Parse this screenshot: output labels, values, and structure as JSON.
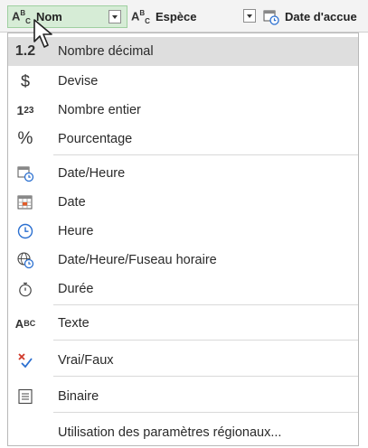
{
  "header": {
    "columns": [
      {
        "type_icon": "text-type-icon",
        "title": "Nom"
      },
      {
        "type_icon": "text-type-icon",
        "title": "Espèce"
      },
      {
        "type_icon": "date-type-icon",
        "title": "Date d'accue"
      }
    ]
  },
  "menu": {
    "items": [
      {
        "icon": "1.2",
        "label": "Nombre décimal"
      },
      {
        "icon": "$",
        "label": "Devise"
      },
      {
        "icon": "123",
        "label": "Nombre entier"
      },
      {
        "icon": "%",
        "label": "Pourcentage"
      },
      {
        "icon": "datetime-icon",
        "label": "Date/Heure"
      },
      {
        "icon": "calendar-icon",
        "label": "Date"
      },
      {
        "icon": "clock-icon",
        "label": "Heure"
      },
      {
        "icon": "globe-clock-icon",
        "label": "Date/Heure/Fuseau horaire"
      },
      {
        "icon": "stopwatch-icon",
        "label": "Durée"
      },
      {
        "icon": "text-type-icon",
        "label": "Texte"
      },
      {
        "icon": "true-false-icon",
        "label": "Vrai/Faux"
      },
      {
        "icon": "binary-icon",
        "label": "Binaire"
      },
      {
        "icon": "",
        "label": "Utilisation des paramètres régionaux..."
      }
    ]
  },
  "colors": {
    "header_bg": "#f3f3f3",
    "selected_col": "#d6ecd6",
    "highlight": "#dedede",
    "true_false_x": "#d03a2a",
    "true_false_check": "#2a6fd0",
    "date_blue": "#2a6fd0"
  }
}
